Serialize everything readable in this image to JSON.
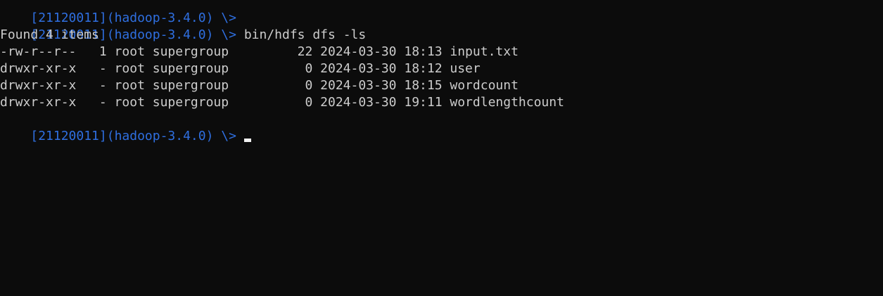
{
  "terminal": {
    "lines": [
      {
        "kind": "prompt",
        "prompt": "[21120011](hadoop-3.4.0) \\>",
        "command": ""
      },
      {
        "kind": "prompt",
        "prompt": "[21120011](hadoop-3.4.0) \\>",
        "command": "bin/hdfs dfs -ls"
      },
      {
        "kind": "output",
        "text": "Found 4 items"
      },
      {
        "kind": "output",
        "text": "-rw-r--r--   1 root supergroup         22 2024-03-30 18:13 input.txt"
      },
      {
        "kind": "output",
        "text": "drwxr-xr-x   - root supergroup          0 2024-03-30 18:12 user"
      },
      {
        "kind": "output",
        "text": "drwxr-xr-x   - root supergroup          0 2024-03-30 18:15 wordcount"
      },
      {
        "kind": "output",
        "text": "drwxr-xr-x   - root supergroup          0 2024-03-30 19:11 wordlengthcount"
      },
      {
        "kind": "prompt",
        "prompt": "[21120011](hadoop-3.4.0) \\>",
        "command": "",
        "cursor": true
      }
    ]
  },
  "colors": {
    "background": "#0c0c0c",
    "foreground": "#cccccc",
    "prompt": "#2f6fe0",
    "cursor": "#f2f2f2"
  }
}
